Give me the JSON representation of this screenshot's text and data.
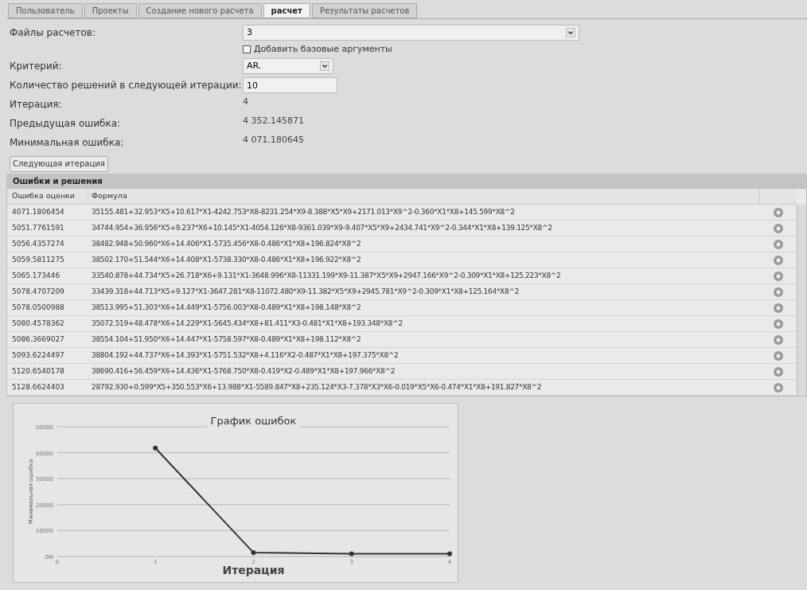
{
  "tabs": [
    {
      "label": "Пользователь",
      "selected": false
    },
    {
      "label": "Проекты",
      "selected": false
    },
    {
      "label": "Создание нового расчета",
      "selected": false
    },
    {
      "label": "расчет",
      "selected": true
    },
    {
      "label": "Результаты расчетов",
      "selected": false
    }
  ],
  "form": {
    "files": {
      "label": "Файлы расчетов:",
      "value": "3"
    },
    "base_args": {
      "label": "Добавить базовые аргументы",
      "checked": false
    },
    "criterion": {
      "label": "Критерий:",
      "value": "AR."
    },
    "solutions": {
      "label": "Количество решений в следующей итерации:",
      "value": "10"
    },
    "iteration": {
      "label": "Итерация:",
      "value": "4"
    },
    "prev_error": {
      "label": "Предыдущая ошибка:",
      "value": "4 352.145871"
    },
    "min_error": {
      "label": "Минимальная ошибка:",
      "value": "4 071.180645"
    }
  },
  "next_button": "Следующая итерация",
  "panel_title": "Ошибки и решения",
  "table": {
    "columns": [
      "Ошибка оценки",
      "Формула"
    ],
    "rows": [
      [
        "4071.1806454",
        "35155.481+32.953*X5+10.617*X1-4242.753*X8-8231.254*X9-8.388*X5*X9+2171.013*X9^2-0.360*X1*X8+145.599*X8^2"
      ],
      [
        "5051.7761591",
        "34744.954+36.956*X5+9.237*X6+10.145*X1-4054.126*X8-9361.039*X9-9.407*X5*X9+2434.741*X9^2-0.344*X1*X8+139.125*X8^2"
      ],
      [
        "5056.4357274",
        "38482.948+50.960*X6+14.406*X1-5735.456*X8-0.486*X1*X8+196.824*X8^2"
      ],
      [
        "5059.5811275",
        "38502.170+51.544*X6+14.408*X1-5738.330*X8-0.486*X1*X8+196.922*X8^2"
      ],
      [
        "5065.173446",
        "33540.878+44.734*X5+26.718*X6+9.131*X1-3648.996*X8-11331.199*X9-11.387*X5*X9+2947.166*X9^2-0.309*X1*X8+125.223*X8^2"
      ],
      [
        "5078.4707209",
        "33439.318+44.713*X5+9.127*X1-3647.281*X8-11072.480*X9-11.382*X5*X9+2945.781*X9^2-0.309*X1*X8+125.164*X8^2"
      ],
      [
        "5078.0500988",
        "38513.995+51.303*X6+14.449*X1-5756.003*X8-0.489*X1*X8+198.148*X8^2"
      ],
      [
        "5080.4578362",
        "35072.519+48.478*X6+14.229*X1-5645.434*X8+81.411*X3-0.481*X1*X8+193.348*X8^2"
      ],
      [
        "5086.3669027",
        "38554.104+51.950*X6+14.447*X1-5758.597*X8-0.489*X1*X8+198.112*X8^2"
      ],
      [
        "5093.6224497",
        "38804.192+44.737*X6+14.393*X1-5751.532*X8+4.116*X2-0.487*X1*X8+197.375*X8^2"
      ],
      [
        "5120.6540178",
        "38690.416+56.459*X6+14.436*X1-5768.750*X8-0.419*X2-0.489*X1*X8+197.966*X8^2"
      ],
      [
        "5128.6624403",
        "28792.930+0.599*X5+350.553*X6+13.988*X1-5589.847*X8+235.124*X3-7.378*X3*X6-0.019*X5*X6-0.474*X1*X8+191.827*X8^2"
      ]
    ]
  },
  "chart": {
    "chart_data": {
      "type": "line",
      "title": "График ошибок",
      "xlabel": "Итерация",
      "ylabel": "Минимальная ошибка",
      "x": [
        1,
        2,
        3,
        4
      ],
      "series": [
        {
          "color": "#333333",
          "marker": true,
          "values": [
            41800,
            1500,
            1100,
            1100
          ]
        }
      ],
      "grid": true,
      "xlim": [
        0,
        4
      ],
      "ylim": [
        0,
        50000
      ],
      "xticks": [
        0,
        1,
        2,
        3,
        4
      ],
      "yticks": [
        {
          "value": 0,
          "label": "0M"
        },
        10000,
        20000,
        30000,
        40000,
        50000
      ]
    }
  }
}
